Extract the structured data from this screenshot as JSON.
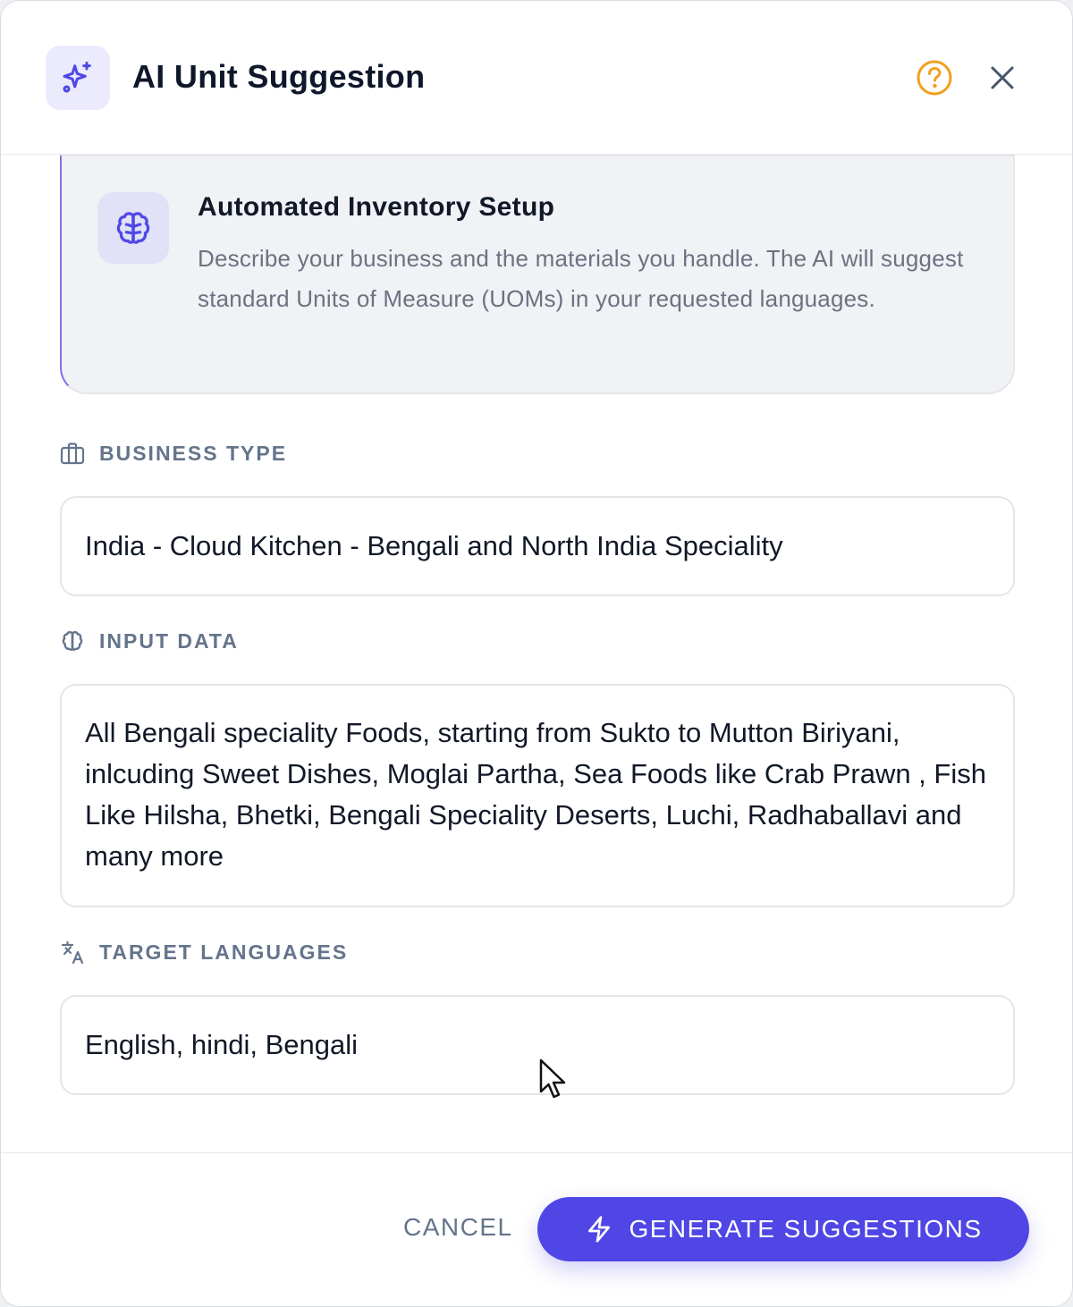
{
  "dialog": {
    "title": "AI Unit Suggestion",
    "header_icon": "sparkles-icon",
    "help_icon": "help-circle-icon",
    "close_icon": "close-icon"
  },
  "info_card": {
    "icon": "brain-icon",
    "title": "Automated Inventory Setup",
    "description": "Describe your business and the materials you handle. The AI will suggest standard Units of Measure (UOMs) in your requested languages."
  },
  "business_type": {
    "label": "BUSINESS TYPE",
    "icon": "briefcase-icon",
    "value": "India - Cloud Kitchen - Bengali and North India Speciality"
  },
  "input_data": {
    "label": "INPUT DATA",
    "icon": "brain-icon",
    "value": "All Bengali speciality Foods, starting from Sukto to Mutton Biriyani, inlcuding Sweet Dishes, Moglai Partha, Sea Foods like Crab Prawn , Fish Like Hilsha, Bhetki, Bengali Speciality Deserts, Luchi, Radhaballavi and many more"
  },
  "target_languages": {
    "label": "TARGET LANGUAGES",
    "icon": "translate-icon",
    "value": "English, hindi, Bengali"
  },
  "footer": {
    "cancel_label": "CANCEL",
    "generate_label": "GENERATE SUGGESTIONS",
    "generate_icon": "lightning-icon"
  },
  "colors": {
    "accent": "#4f46e5",
    "help": "#f0a020",
    "label": "#64748b"
  }
}
